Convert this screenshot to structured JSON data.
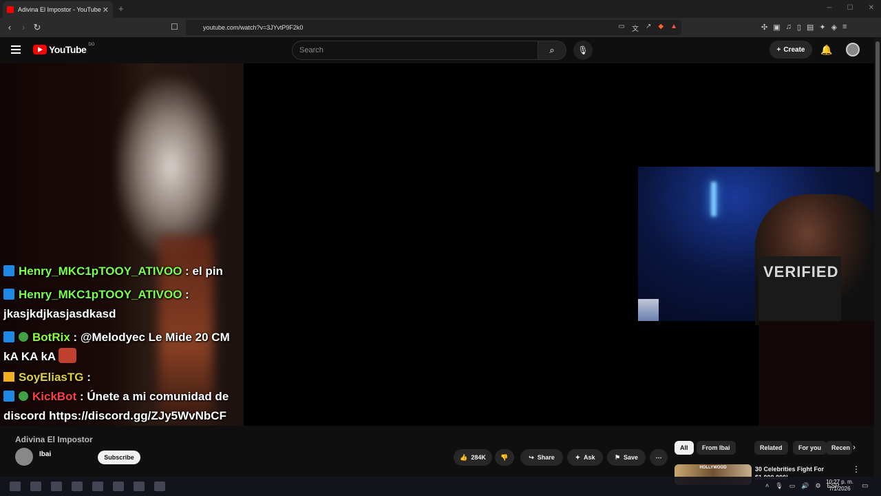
{
  "browser": {
    "tab_title": "Adivina El Impostor - YouTube",
    "tab_close": "✕",
    "new_tab": "+",
    "url": "youtube.com/watch?v=3JYvtP9F2k0",
    "window_controls": [
      "─",
      "☐",
      "✕"
    ]
  },
  "youtube": {
    "logo_text": "YouTube",
    "logo_country": "DO",
    "search_placeholder": "Search",
    "create_label": "Create"
  },
  "chat": [
    {
      "badges": [
        "prime"
      ],
      "user": "Henry_MKC1pTOOY_ATIVOO",
      "sep": " : ",
      "message": "el pin",
      "color": "green"
    },
    {
      "badges": [
        "prime"
      ],
      "user": "Henry_MKC1pTOOY_ATIVOO",
      "sep": " :",
      "message": "jkasjkdjkasjasdkasd",
      "color": "green"
    },
    {
      "badges": [
        "prime",
        "verified"
      ],
      "user": "BotRix",
      "sep": " : ",
      "message": "@Melodyec Le Mide 20 CM kA KA kA",
      "color": "lime"
    },
    {
      "badges": [
        "crown"
      ],
      "user": "SoyEliasTG",
      "sep": " :",
      "message": "",
      "color": "yellow"
    },
    {
      "badges": [
        "prime",
        "verified"
      ],
      "user": "KickBot",
      "sep": " : ",
      "message": "Únete a mi comunidad de discord https://discord.gg/ZJy5WvNbCF",
      "color": "red"
    }
  ],
  "video_info": {
    "title": "Adivina El Impostor",
    "channel": "Ibai",
    "subscribers": "",
    "subscribe_label": "Subscribe",
    "likes": "284K",
    "share_label": "Share",
    "ask_label": "Ask",
    "save_label": "Save"
  },
  "filter_chips": [
    "All",
    "From Ibai",
    "Related",
    "For you",
    "Recen"
  ],
  "recommendation": {
    "title": "30 Celebrities Fight For $1,000,000!",
    "thumb_text": "HOLLYWOOD"
  },
  "taskbar": {
    "time": "10:27 p. m.",
    "date": "7/1/2026",
    "language": "ESP"
  },
  "colors": {
    "yt_red": "#ff0000",
    "background": "#0f0f0f",
    "chip_active": "#f1f1f1"
  }
}
